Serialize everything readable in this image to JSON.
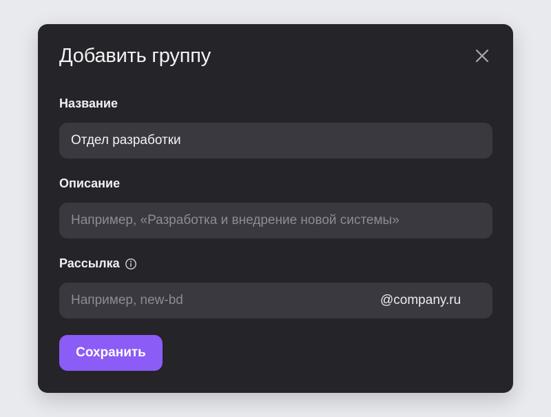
{
  "dialog": {
    "title": "Добавить группу",
    "close_icon": "close-icon"
  },
  "fields": {
    "name": {
      "label": "Название",
      "value": "Отдел разработки",
      "placeholder": ""
    },
    "description": {
      "label": "Описание",
      "value": "",
      "placeholder": "Например, «Разработка и внедрение новой системы»"
    },
    "mailing": {
      "label": "Рассылка",
      "info_icon": "info-icon",
      "value": "",
      "placeholder": "Например, new-bd",
      "suffix": "@company.ru"
    }
  },
  "actions": {
    "save_label": "Сохранить"
  },
  "colors": {
    "background": "#e9eaee",
    "dialog": "#252429",
    "field": "#3a393f",
    "accent": "#8b5cf6",
    "text": "#f3f3f5",
    "placeholder": "#8d8c93"
  }
}
